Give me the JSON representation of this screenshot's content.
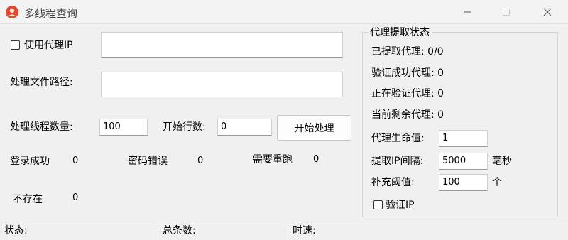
{
  "window": {
    "title": "多线程查询",
    "icon": "user-avatar-icon",
    "accent_color": "#e8462f"
  },
  "left": {
    "use_proxy": {
      "label": "使用代理IP",
      "checked": false,
      "value": ""
    },
    "file_path": {
      "label": "处理文件路径:",
      "value": ""
    },
    "thread_count": {
      "label": "处理线程数量:",
      "value": "100"
    },
    "start_row": {
      "label": "开始行数:",
      "value": "0"
    },
    "start_button": "开始处理",
    "stats": {
      "login_success": {
        "label": "登录成功",
        "value": "0"
      },
      "password_error": {
        "label": "密码错误",
        "value": "0"
      },
      "need_rerun": {
        "label": "需要重跑",
        "value": "0"
      },
      "not_exist": {
        "label": "不存在",
        "value": "0"
      }
    }
  },
  "proxy_panel": {
    "title": "代理提取状态",
    "extracted": "已提取代理: 0/0",
    "verified_success": "验证成功代理: 0",
    "verifying": "正在验证代理: 0",
    "remaining": "当前剩余代理: 0",
    "lifetime": {
      "label": "代理生命值:",
      "value": "1"
    },
    "interval": {
      "label": "提取IP间隔:",
      "value": "5000",
      "unit": "毫秒"
    },
    "threshold": {
      "label": "补充阈值:",
      "value": "100",
      "unit": "个"
    },
    "verify_ip": {
      "label": "验证IP",
      "checked": false
    }
  },
  "statusbar": {
    "status": "状态:",
    "total": "总条数:",
    "speed": "时速:"
  }
}
